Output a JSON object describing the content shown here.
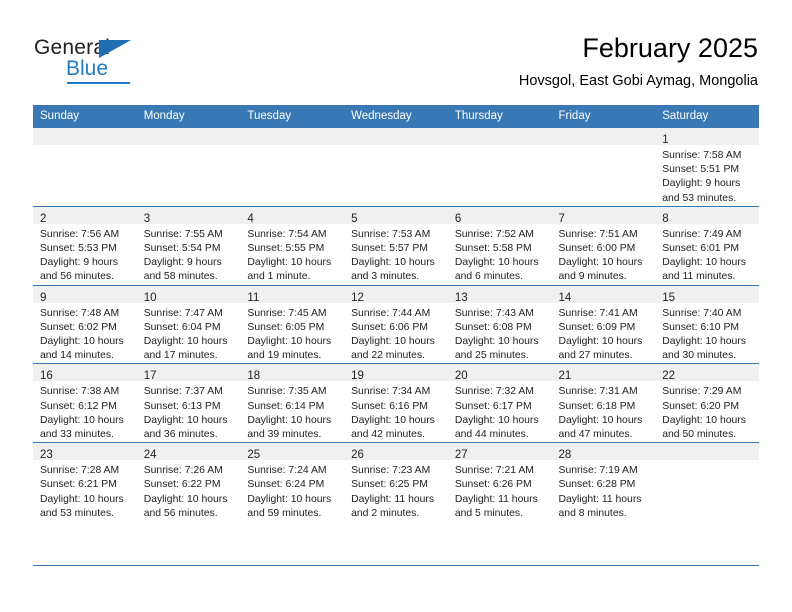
{
  "brand": {
    "name_part1": "General",
    "name_part2": "Blue",
    "logo_icon": "triangle-flag-icon",
    "accent_color": "#1f7bc4"
  },
  "header": {
    "title": "February 2025",
    "subtitle": "Hovsgol, East Gobi Aymag, Mongolia"
  },
  "theme": {
    "header_bg": "#3878b4",
    "daynum_bg": "#f0f0f0",
    "rule_color": "#3878b4",
    "text_color": "#222222"
  },
  "calendar": {
    "weekday_headers": [
      "Sunday",
      "Monday",
      "Tuesday",
      "Wednesday",
      "Thursday",
      "Friday",
      "Saturday"
    ],
    "weeks": [
      [
        {
          "day": "",
          "lines": []
        },
        {
          "day": "",
          "lines": []
        },
        {
          "day": "",
          "lines": []
        },
        {
          "day": "",
          "lines": []
        },
        {
          "day": "",
          "lines": []
        },
        {
          "day": "",
          "lines": []
        },
        {
          "day": "1",
          "lines": [
            "Sunrise: 7:58 AM",
            "Sunset: 5:51 PM",
            "Daylight: 9 hours",
            "and 53 minutes."
          ]
        }
      ],
      [
        {
          "day": "2",
          "lines": [
            "Sunrise: 7:56 AM",
            "Sunset: 5:53 PM",
            "Daylight: 9 hours",
            "and 56 minutes."
          ]
        },
        {
          "day": "3",
          "lines": [
            "Sunrise: 7:55 AM",
            "Sunset: 5:54 PM",
            "Daylight: 9 hours",
            "and 58 minutes."
          ]
        },
        {
          "day": "4",
          "lines": [
            "Sunrise: 7:54 AM",
            "Sunset: 5:55 PM",
            "Daylight: 10 hours",
            "and 1 minute."
          ]
        },
        {
          "day": "5",
          "lines": [
            "Sunrise: 7:53 AM",
            "Sunset: 5:57 PM",
            "Daylight: 10 hours",
            "and 3 minutes."
          ]
        },
        {
          "day": "6",
          "lines": [
            "Sunrise: 7:52 AM",
            "Sunset: 5:58 PM",
            "Daylight: 10 hours",
            "and 6 minutes."
          ]
        },
        {
          "day": "7",
          "lines": [
            "Sunrise: 7:51 AM",
            "Sunset: 6:00 PM",
            "Daylight: 10 hours",
            "and 9 minutes."
          ]
        },
        {
          "day": "8",
          "lines": [
            "Sunrise: 7:49 AM",
            "Sunset: 6:01 PM",
            "Daylight: 10 hours",
            "and 11 minutes."
          ]
        }
      ],
      [
        {
          "day": "9",
          "lines": [
            "Sunrise: 7:48 AM",
            "Sunset: 6:02 PM",
            "Daylight: 10 hours",
            "and 14 minutes."
          ]
        },
        {
          "day": "10",
          "lines": [
            "Sunrise: 7:47 AM",
            "Sunset: 6:04 PM",
            "Daylight: 10 hours",
            "and 17 minutes."
          ]
        },
        {
          "day": "11",
          "lines": [
            "Sunrise: 7:45 AM",
            "Sunset: 6:05 PM",
            "Daylight: 10 hours",
            "and 19 minutes."
          ]
        },
        {
          "day": "12",
          "lines": [
            "Sunrise: 7:44 AM",
            "Sunset: 6:06 PM",
            "Daylight: 10 hours",
            "and 22 minutes."
          ]
        },
        {
          "day": "13",
          "lines": [
            "Sunrise: 7:43 AM",
            "Sunset: 6:08 PM",
            "Daylight: 10 hours",
            "and 25 minutes."
          ]
        },
        {
          "day": "14",
          "lines": [
            "Sunrise: 7:41 AM",
            "Sunset: 6:09 PM",
            "Daylight: 10 hours",
            "and 27 minutes."
          ]
        },
        {
          "day": "15",
          "lines": [
            "Sunrise: 7:40 AM",
            "Sunset: 6:10 PM",
            "Daylight: 10 hours",
            "and 30 minutes."
          ]
        }
      ],
      [
        {
          "day": "16",
          "lines": [
            "Sunrise: 7:38 AM",
            "Sunset: 6:12 PM",
            "Daylight: 10 hours",
            "and 33 minutes."
          ]
        },
        {
          "day": "17",
          "lines": [
            "Sunrise: 7:37 AM",
            "Sunset: 6:13 PM",
            "Daylight: 10 hours",
            "and 36 minutes."
          ]
        },
        {
          "day": "18",
          "lines": [
            "Sunrise: 7:35 AM",
            "Sunset: 6:14 PM",
            "Daylight: 10 hours",
            "and 39 minutes."
          ]
        },
        {
          "day": "19",
          "lines": [
            "Sunrise: 7:34 AM",
            "Sunset: 6:16 PM",
            "Daylight: 10 hours",
            "and 42 minutes."
          ]
        },
        {
          "day": "20",
          "lines": [
            "Sunrise: 7:32 AM",
            "Sunset: 6:17 PM",
            "Daylight: 10 hours",
            "and 44 minutes."
          ]
        },
        {
          "day": "21",
          "lines": [
            "Sunrise: 7:31 AM",
            "Sunset: 6:18 PM",
            "Daylight: 10 hours",
            "and 47 minutes."
          ]
        },
        {
          "day": "22",
          "lines": [
            "Sunrise: 7:29 AM",
            "Sunset: 6:20 PM",
            "Daylight: 10 hours",
            "and 50 minutes."
          ]
        }
      ],
      [
        {
          "day": "23",
          "lines": [
            "Sunrise: 7:28 AM",
            "Sunset: 6:21 PM",
            "Daylight: 10 hours",
            "and 53 minutes."
          ]
        },
        {
          "day": "24",
          "lines": [
            "Sunrise: 7:26 AM",
            "Sunset: 6:22 PM",
            "Daylight: 10 hours",
            "and 56 minutes."
          ]
        },
        {
          "day": "25",
          "lines": [
            "Sunrise: 7:24 AM",
            "Sunset: 6:24 PM",
            "Daylight: 10 hours",
            "and 59 minutes."
          ]
        },
        {
          "day": "26",
          "lines": [
            "Sunrise: 7:23 AM",
            "Sunset: 6:25 PM",
            "Daylight: 11 hours",
            "and 2 minutes."
          ]
        },
        {
          "day": "27",
          "lines": [
            "Sunrise: 7:21 AM",
            "Sunset: 6:26 PM",
            "Daylight: 11 hours",
            "and 5 minutes."
          ]
        },
        {
          "day": "28",
          "lines": [
            "Sunrise: 7:19 AM",
            "Sunset: 6:28 PM",
            "Daylight: 11 hours",
            "and 8 minutes."
          ]
        },
        {
          "day": "",
          "lines": []
        }
      ]
    ]
  }
}
